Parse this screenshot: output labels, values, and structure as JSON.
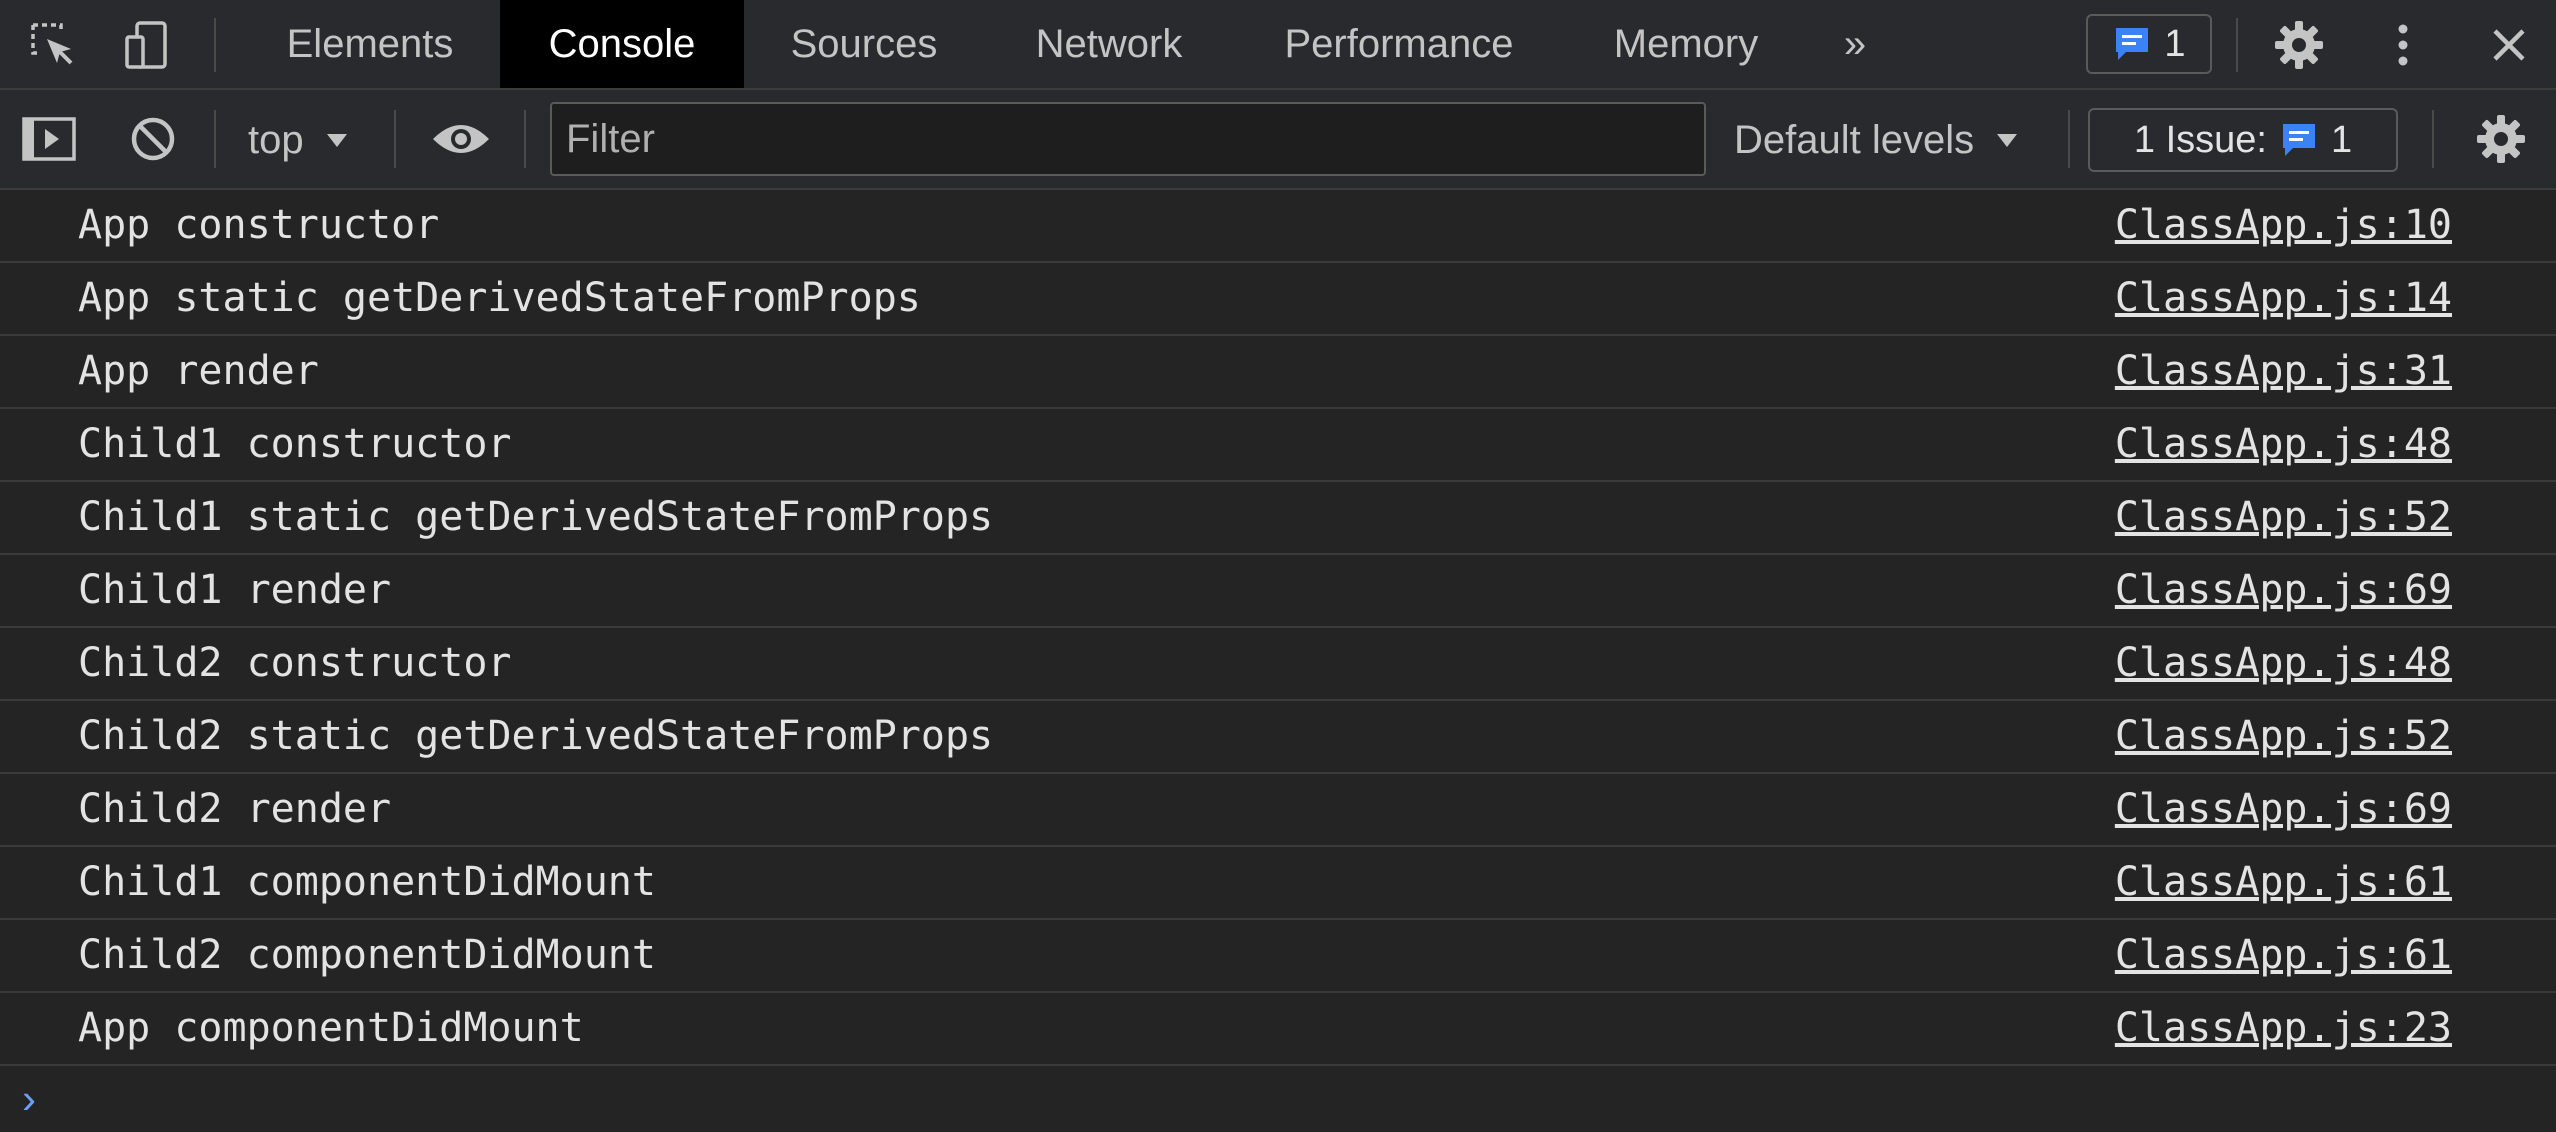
{
  "tabs": [
    {
      "label": "Elements"
    },
    {
      "label": "Console"
    },
    {
      "label": "Sources"
    },
    {
      "label": "Network"
    },
    {
      "label": "Performance"
    },
    {
      "label": "Memory"
    }
  ],
  "active_tab": "Console",
  "more_tabs_glyph": "»",
  "messages_badge": {
    "count": "1"
  },
  "toolbar": {
    "context": "top",
    "filter_placeholder": "Filter",
    "levels": "Default levels",
    "issues_label": "1 Issue:",
    "issues_count": "1"
  },
  "console_rows": [
    {
      "message": "App constructor",
      "source": "ClassApp.js:10"
    },
    {
      "message": "App static getDerivedStateFromProps",
      "source": "ClassApp.js:14"
    },
    {
      "message": "App render",
      "source": "ClassApp.js:31"
    },
    {
      "message": "Child1 constructor",
      "source": "ClassApp.js:48"
    },
    {
      "message": "Child1 static getDerivedStateFromProps",
      "source": "ClassApp.js:52"
    },
    {
      "message": "Child1 render",
      "source": "ClassApp.js:69"
    },
    {
      "message": "Child2 constructor",
      "source": "ClassApp.js:48"
    },
    {
      "message": "Child2 static getDerivedStateFromProps",
      "source": "ClassApp.js:52"
    },
    {
      "message": "Child2 render",
      "source": "ClassApp.js:69"
    },
    {
      "message": "Child1 componentDidMount",
      "source": "ClassApp.js:61"
    },
    {
      "message": "Child2 componentDidMount",
      "source": "ClassApp.js:61"
    },
    {
      "message": "App componentDidMount",
      "source": "ClassApp.js:23"
    }
  ],
  "prompt_glyph": "›",
  "icons": {
    "inspect": "inspect-element-icon",
    "device": "device-toolbar-icon",
    "settings": "gear-icon",
    "more": "kebab-menu-icon",
    "close": "close-icon",
    "sidebar": "sidebar-toggle-icon",
    "clear": "clear-console-icon",
    "eye": "live-expression-icon",
    "message": "message-icon"
  },
  "colors": {
    "panel_bg": "#242424",
    "toolbar_bg": "#292a2d",
    "active_tab_bg": "#000000",
    "accent_blue": "#3b82f6",
    "text": "#e3e3e3"
  }
}
